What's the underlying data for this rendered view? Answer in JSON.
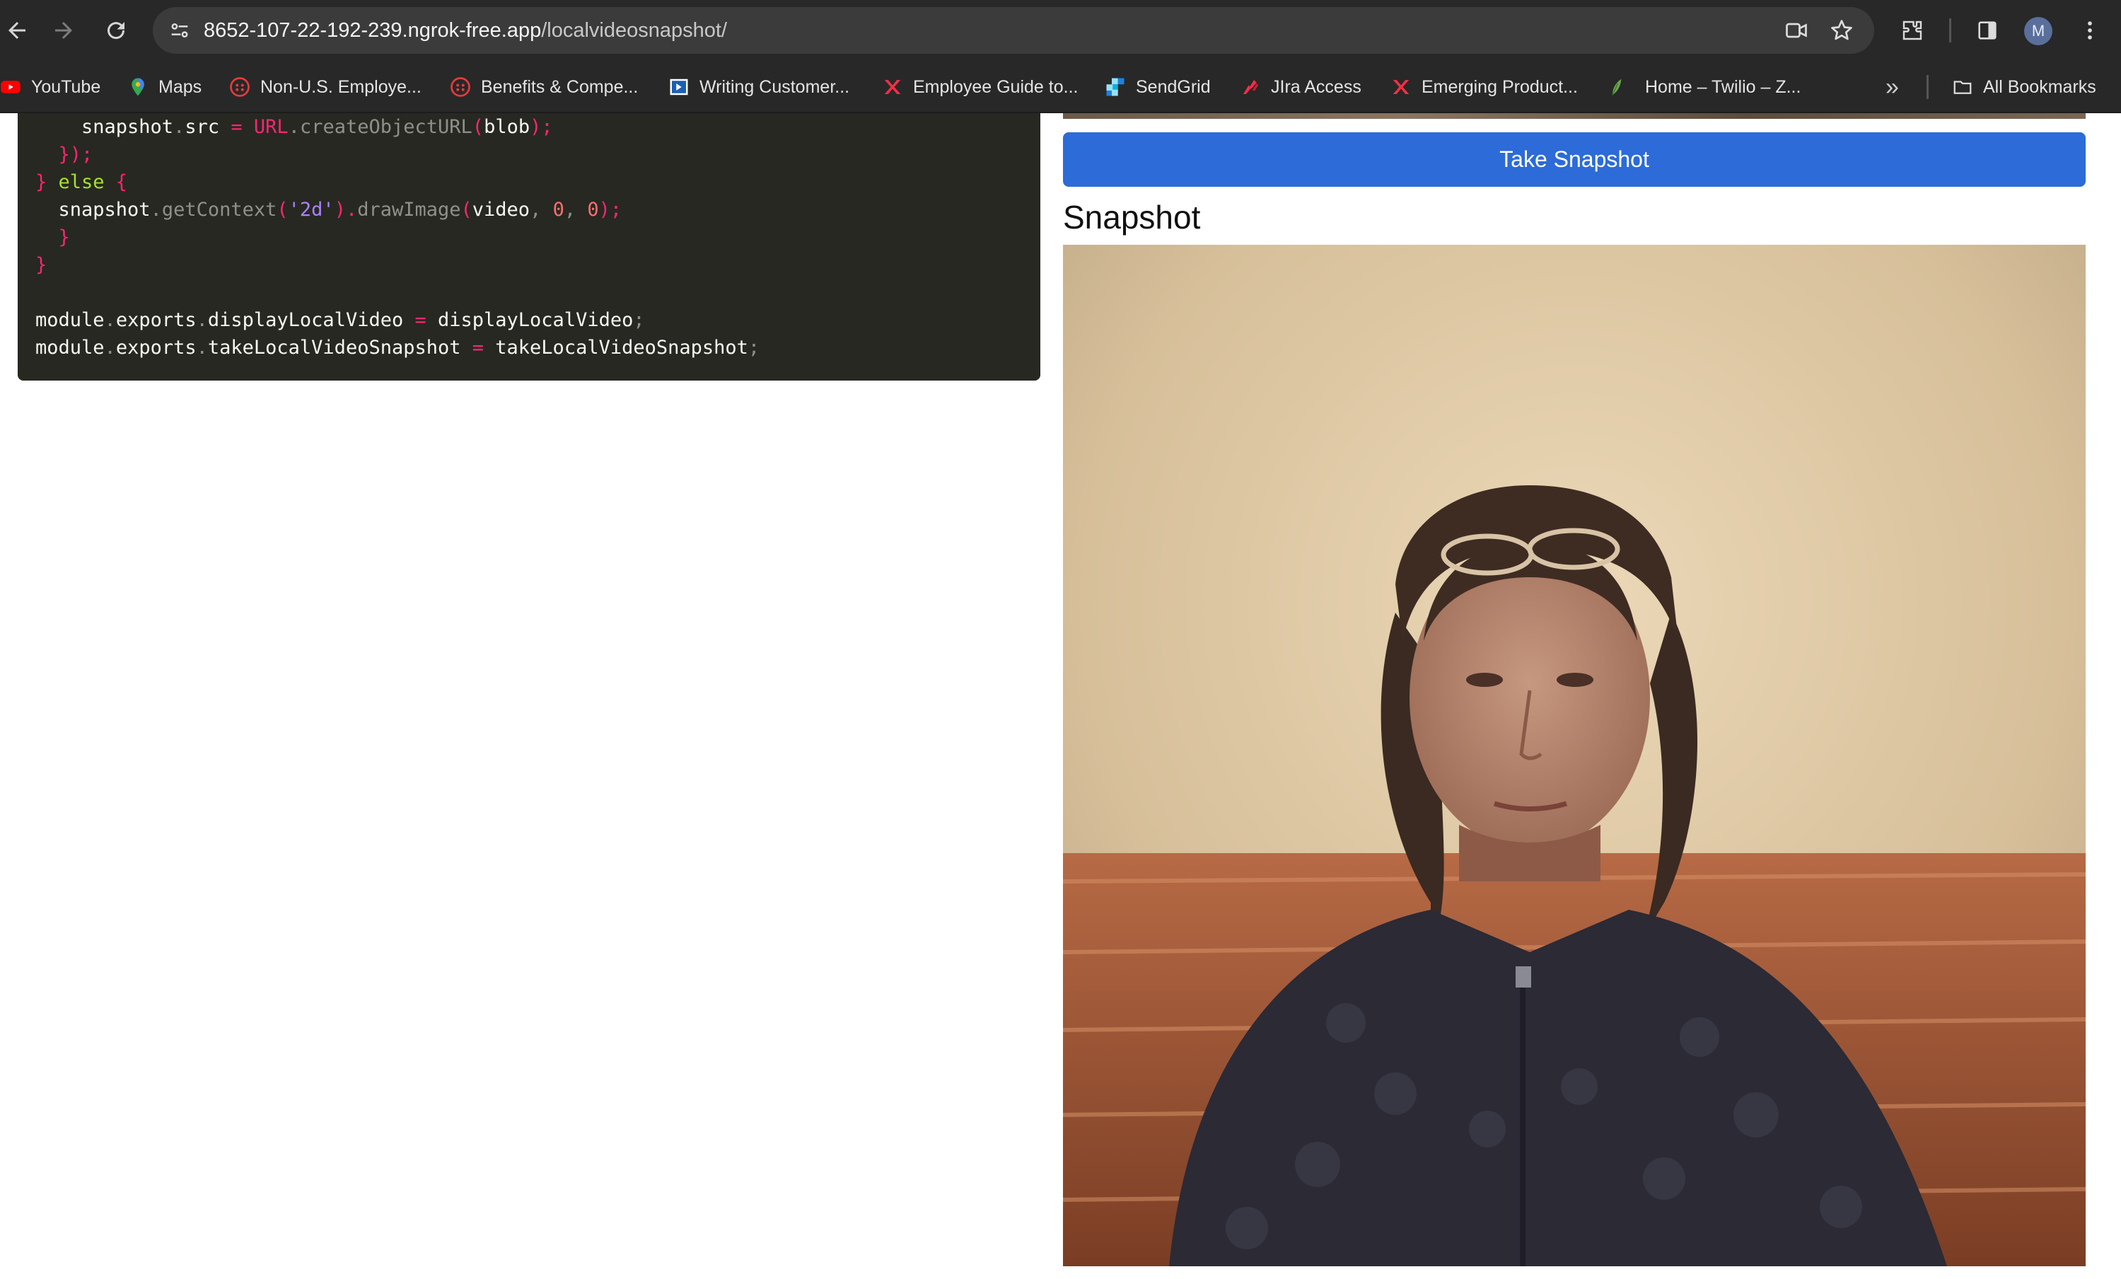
{
  "browser": {
    "url_host": "8652-107-22-192-239.ngrok-free.app",
    "url_path": "/localvideosnapshot/",
    "avatar_initial": "M",
    "icons": [
      "back-icon",
      "forward-icon",
      "reload-icon",
      "site-info-icon",
      "camera-icon",
      "star-icon",
      "extensions-icon",
      "side-panel-icon",
      "menu-icon"
    ]
  },
  "bookmarks": {
    "items": [
      {
        "label": "YouTube",
        "icon": "youtube-icon"
      },
      {
        "label": "Maps",
        "icon": "maps-icon"
      },
      {
        "label": "Non-U.S. Employe...",
        "icon": "workday-icon"
      },
      {
        "label": "Benefits & Compe...",
        "icon": "workday-icon"
      },
      {
        "label": "Writing Customer...",
        "icon": "doc-icon"
      },
      {
        "label": "Employee Guide to...",
        "icon": "twilio-x-icon"
      },
      {
        "label": "SendGrid",
        "icon": "sendgrid-icon"
      },
      {
        "label": "JIra Access",
        "icon": "jira-icon"
      },
      {
        "label": "Emerging Product...",
        "icon": "twilio-x-icon"
      },
      {
        "label": "Home – Twilio – Z...",
        "icon": "leaf-icon"
      }
    ],
    "overflow_label": "»",
    "all_bookmarks_label": "All Bookmarks"
  },
  "code": {
    "line1": {
      "a": "    snapshot",
      "b": ".",
      "c": "src",
      "d": " = ",
      "e": "URL",
      "f": ".",
      "g": "createObjectURL",
      "h": "(",
      "i": "blob",
      "j": ");"
    },
    "line2": {
      "a": "  });"
    },
    "line3": {
      "a": "} ",
      "b": "else",
      "c": " {"
    },
    "line4": {
      "a": "  snapshot",
      "b": ".",
      "c": "getContext",
      "d": "(",
      "e": "'2d'",
      "f": ").",
      "g": "drawImage",
      "h": "(",
      "i": "video",
      "j": ", ",
      "k": "0",
      "l": ", ",
      "m": "0",
      "n": ");"
    },
    "line5": {
      "a": "  }"
    },
    "line6": {
      "a": "}"
    },
    "line8": {
      "a": "module",
      "b": ".",
      "c": "exports",
      "d": ".",
      "e": "displayLocalVideo",
      "f": " = ",
      "g": "displayLocalVideo",
      "h": ";"
    },
    "line9": {
      "a": "module",
      "b": ".",
      "c": "exports",
      "d": ".",
      "e": "takeLocalVideoSnapshot",
      "f": " = ",
      "g": "takeLocalVideoSnapshot",
      "h": ";"
    }
  },
  "snapshot_panel": {
    "button_label": "Take Snapshot",
    "heading": "Snapshot"
  }
}
